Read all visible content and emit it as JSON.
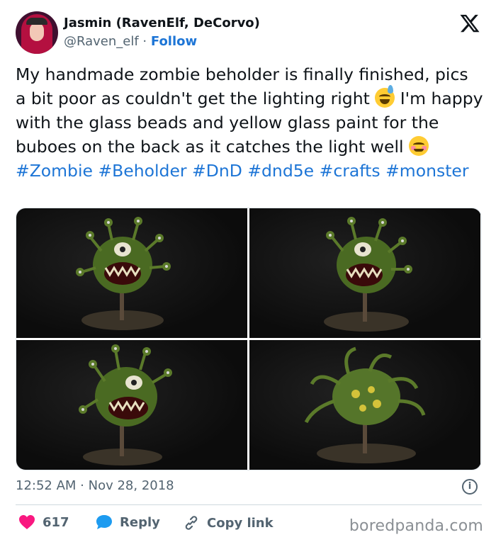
{
  "author": {
    "name": "Jasmin (RavenElf, DeCorvo)",
    "handle": "@Raven_elf",
    "separator": " · ",
    "follow_label": "Follow"
  },
  "tweet": {
    "line1": "My handmade zombie beholder is finally finished, pics a bit poor as couldn't get the lighting right ",
    "line2": " I'm happy with the glass beads and yellow glass paint for the buboes on the back as it catches the light well ",
    "hashtags": [
      "#Zombie",
      "#Beholder",
      "#DnD",
      "#dnd5e",
      "#crafts",
      "#monster"
    ],
    "emoji": [
      "sweat-smile-emoji",
      "blush-emoji"
    ]
  },
  "images": [
    {
      "alt": "beholder-photo-1"
    },
    {
      "alt": "beholder-photo-2"
    },
    {
      "alt": "beholder-photo-3"
    },
    {
      "alt": "beholder-photo-4"
    }
  ],
  "meta": {
    "time": "12:52 AM",
    "separator": " · ",
    "date": "Nov 28, 2018"
  },
  "actions": {
    "likes": "617",
    "reply_label": "Reply",
    "copy_label": "Copy link"
  },
  "watermark": "boredpanda.com",
  "colors": {
    "link": "#1d75d6",
    "heart": "#f91880",
    "reply_bubble": "#1d9bf0",
    "muted": "#536471"
  },
  "icons": {
    "brand": "x-logo-icon",
    "info": "info-icon",
    "like": "heart-icon",
    "reply": "reply-bubble-icon",
    "copy": "link-icon"
  }
}
